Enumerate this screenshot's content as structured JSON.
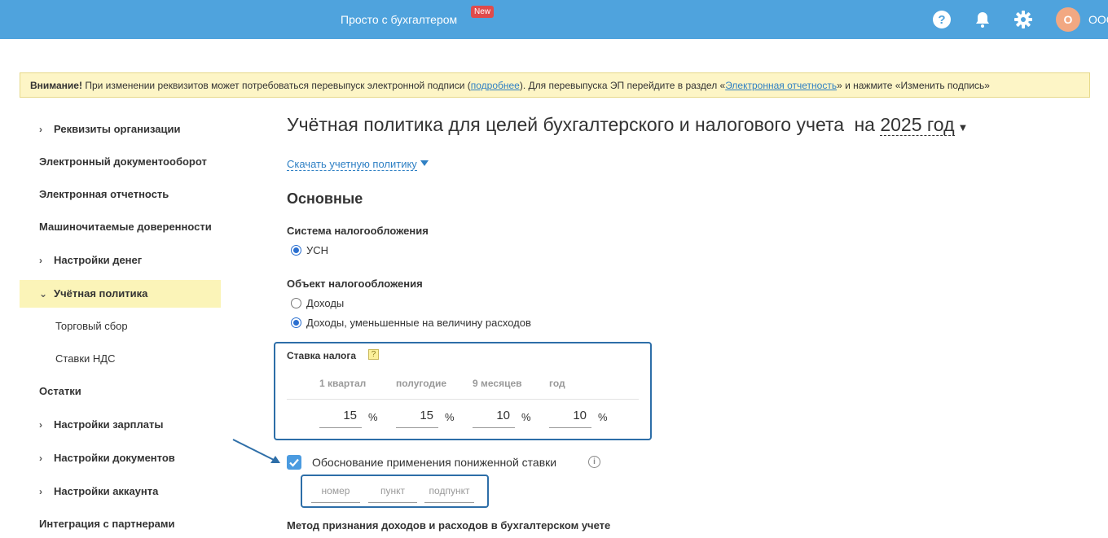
{
  "header": {
    "brand": "Просто с бухгалтером",
    "badge": "New",
    "avatar_letter": "О",
    "org_name": "ООО",
    "icons": [
      "help-icon",
      "bell-icon",
      "gear-icon"
    ],
    "bg_color": "#4fa3dd"
  },
  "warning": {
    "bold": "Внимание!",
    "text1": " При изменении реквизитов может потребоваться перевыпуск электронной подписи (",
    "link1": "подробнее",
    "text2": "). Для перевыпуска ЭП перейдите в раздел «",
    "link2": "Электронная отчетность",
    "text3": "» и нажмите «Изменить подпись»"
  },
  "sidebar": {
    "items": [
      {
        "label": "Реквизиты организации"
      },
      {
        "label": "Электронный документооборот"
      },
      {
        "label": "Электронная отчетность"
      },
      {
        "label": "Машиночитаемые доверенности"
      },
      {
        "label": "Настройки денег"
      },
      {
        "label": "Учётная политика"
      },
      {
        "label": "Торговый сбор"
      },
      {
        "label": "Ставки НДС"
      },
      {
        "label": "Остатки"
      },
      {
        "label": "Настройки зарплаты"
      },
      {
        "label": "Настройки документов"
      },
      {
        "label": "Настройки аккаунта"
      },
      {
        "label": "Интеграция с партнерами"
      }
    ]
  },
  "page": {
    "title": "Учётная политика для целей бухгалтерского и налогового учета",
    "year_prefix": "на",
    "year": "2025 год",
    "download": "Скачать учетную политику",
    "section": "Основные"
  },
  "tax_system": {
    "label": "Система налогообложения",
    "option": "УСН"
  },
  "tax_object": {
    "label": "Объект налогообложения",
    "options": [
      "Доходы",
      "Доходы, уменьшенные на величину расходов"
    ],
    "selected_index": 1
  },
  "tax_rate": {
    "label": "Ставка налога",
    "help": "?",
    "columns": [
      "1 квартал",
      "полугодие",
      "9 месяцев",
      "год"
    ],
    "values": [
      "15",
      "15",
      "10",
      "10"
    ],
    "unit": "%"
  },
  "reduced_rate": {
    "label": "Обоснование применения пониженной ставки",
    "checked": true,
    "info": "i",
    "placeholders": [
      "номер",
      "пункт",
      "подпункт"
    ]
  },
  "method": {
    "label": "Метод признания доходов и расходов в бухгалтерском учете"
  }
}
